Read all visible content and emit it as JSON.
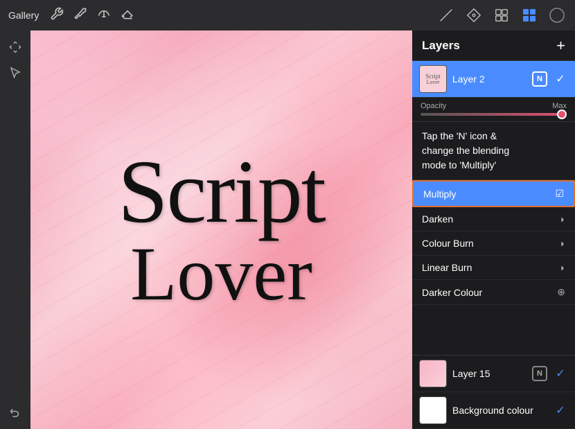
{
  "toolbar": {
    "gallery_label": "Gallery",
    "add_label": "+",
    "layers_title": "Layers"
  },
  "layers": {
    "layer2": {
      "name": "Layer 2",
      "mode": "N",
      "checked": true,
      "selected": true
    },
    "opacity": {
      "label": "Opacity",
      "max_label": "Max"
    },
    "instruction": "Tap the 'N' icon &\nchange the blending\nmode to 'Multiply'",
    "blend_modes": [
      {
        "name": "Multiply",
        "active": true,
        "icon": "☑"
      },
      {
        "name": "Darken",
        "active": false,
        "icon": "◗"
      },
      {
        "name": "Colour Burn",
        "active": false,
        "icon": "◗"
      },
      {
        "name": "Linear Burn",
        "active": false,
        "icon": "◗"
      },
      {
        "name": "Darker Colour",
        "active": false,
        "icon": "⊕"
      }
    ],
    "layer15": {
      "name": "Layer 15",
      "mode": "N",
      "checked": true
    },
    "bg": {
      "name": "Background colour",
      "checked": true
    }
  },
  "canvas": {
    "line1": "Script",
    "line2": "Lover"
  }
}
